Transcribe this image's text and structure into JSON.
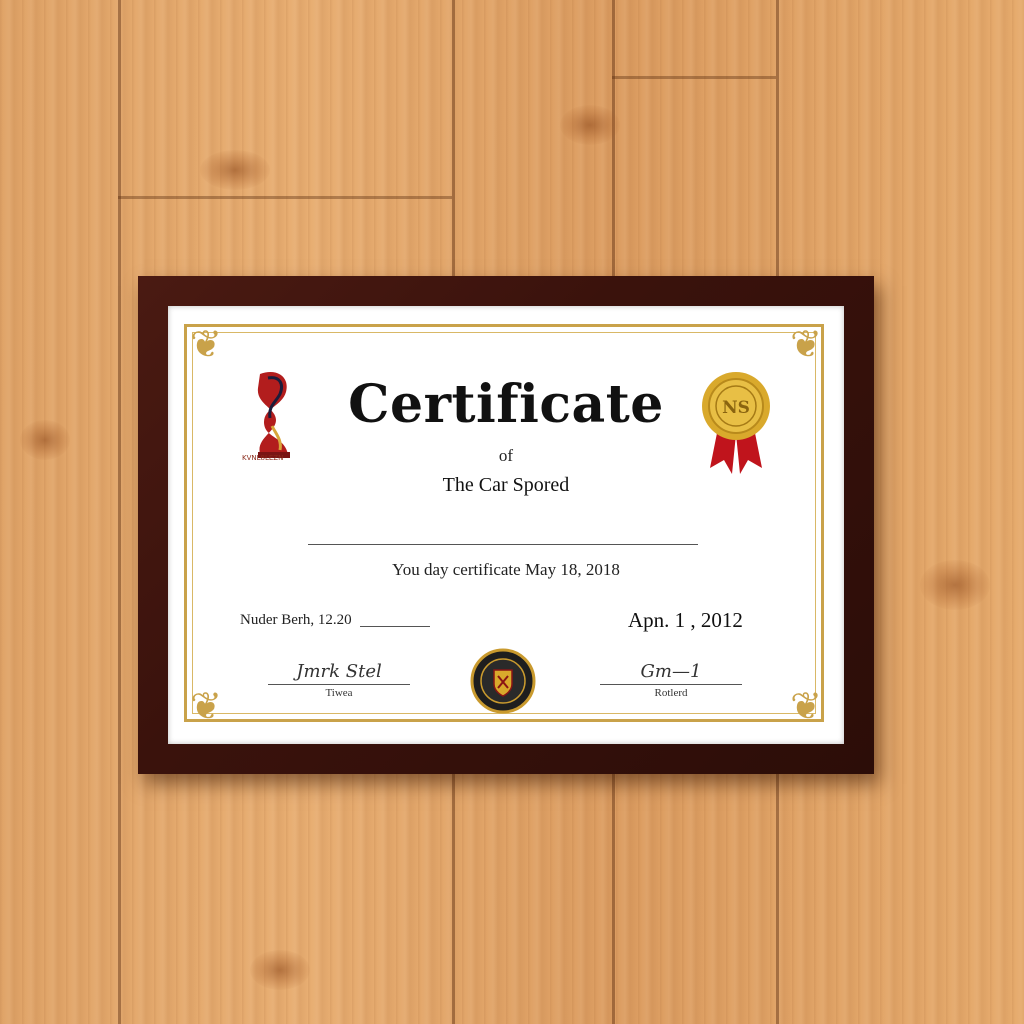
{
  "certificate": {
    "title": "Certificate",
    "of": "of",
    "subtitle": "The Car Spored",
    "statement": "You day certificate May 18, 2018",
    "left_date": "Nuder Berh, 12.20",
    "right_date": "Apn. 1 , 2012",
    "left_signature_caption": "Tiwea",
    "right_signature_caption": "Rotlerd",
    "left_signature_script": "Jmrk Stel",
    "right_signature_script": "Gm—1",
    "logo_caption": "KVNL8LEZN",
    "rosette_text": "NS"
  },
  "colors": {
    "frame": "#3a120c",
    "gold": "#c9a24a",
    "ribbon": "#c0141c",
    "wall": "#e0a468"
  }
}
